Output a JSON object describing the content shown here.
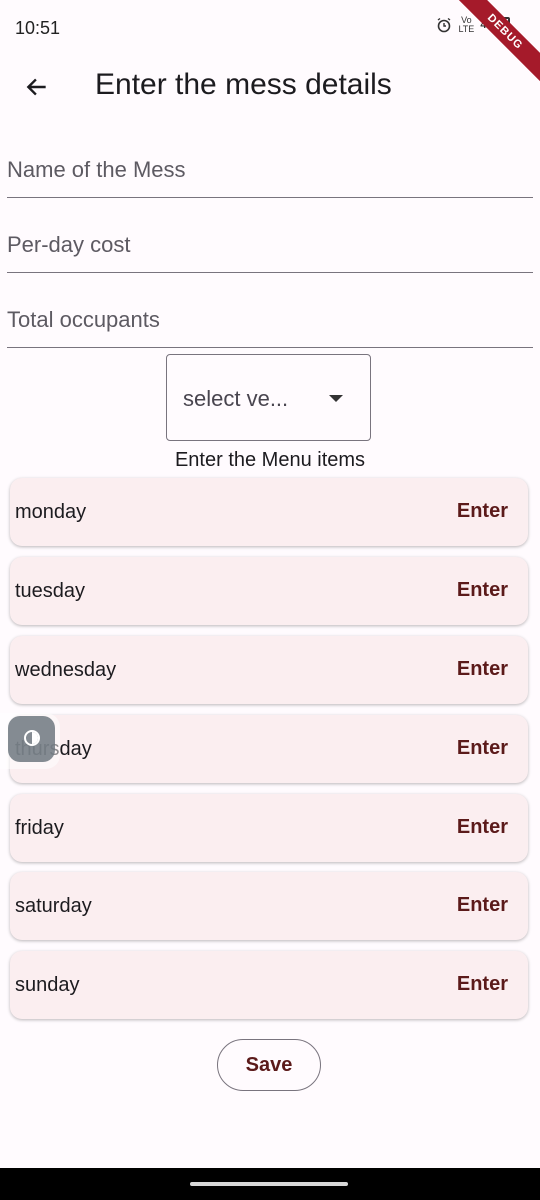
{
  "status_bar": {
    "time": "10:51",
    "volte_top": "Vo",
    "volte_bottom": "LTE",
    "network": "4G"
  },
  "debug_banner": "DEBUG",
  "app_bar": {
    "title": "Enter the mess details"
  },
  "form": {
    "mess_name_placeholder": "Name of the Mess",
    "cost_placeholder": "Per-day cost",
    "occupants_placeholder": "Total occupants",
    "dropdown_value": "select ve..."
  },
  "menu": {
    "heading": "Enter the Menu items",
    "enter_label": "Enter",
    "days": [
      "monday",
      "tuesday",
      "wednesday",
      "thursday",
      "friday",
      "saturday",
      "sunday"
    ]
  },
  "save_label": "Save",
  "icons": {
    "back": "arrow-left-icon",
    "dropdown": "triangle-down-icon",
    "floating": "contrast-icon",
    "alarm": "alarm-icon",
    "battery": "battery-icon"
  },
  "colors": {
    "background": "#fffbfe",
    "card": "#fbeef0",
    "accent": "#5b1a1a",
    "debug": "#a51a2a"
  }
}
